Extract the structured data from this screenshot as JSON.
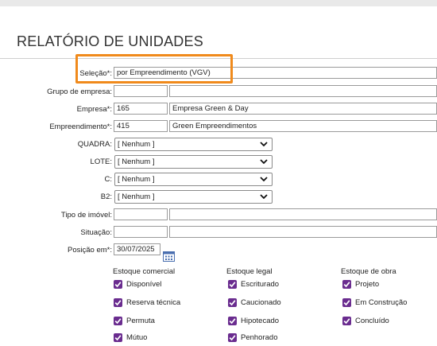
{
  "title": "RELATÓRIO DE UNIDADES",
  "form": {
    "selecao": {
      "label": "Seleção*:",
      "value": "por Empreendimento (VGV)"
    },
    "grupo": {
      "label": "Grupo de empresa:",
      "code": "",
      "name": ""
    },
    "empresa": {
      "label": "Empresa*:",
      "code": "165",
      "name": "Empresa Green & Day"
    },
    "empreendimento": {
      "label": "Empreendimento*:",
      "code": "415",
      "name": "Green Empreendimentos"
    },
    "quadra": {
      "label": "QUADRA:",
      "value": "[ Nenhum ]"
    },
    "lote": {
      "label": "LOTE:",
      "value": "[ Nenhum ]"
    },
    "c": {
      "label": "C:",
      "value": "[ Nenhum ]"
    },
    "b2": {
      "label": "B2:",
      "value": "[ Nenhum ]"
    },
    "tipo_imovel": {
      "label": "Tipo de imóvel:",
      "code": "",
      "name": ""
    },
    "situacao": {
      "label": "Situação:",
      "code": "",
      "name": ""
    },
    "posicao": {
      "label": "Posição em*:",
      "value": "30/07/2025"
    }
  },
  "estoque_comercial": {
    "header": "Estoque comercial",
    "items": [
      {
        "label": "Disponível",
        "checked": true
      },
      {
        "label": "Reserva técnica",
        "checked": true
      },
      {
        "label": "Permuta",
        "checked": true
      },
      {
        "label": "Mútuo",
        "checked": true
      }
    ]
  },
  "estoque_legal": {
    "header": "Estoque legal",
    "items": [
      {
        "label": "Escriturado",
        "checked": true
      },
      {
        "label": "Caucionado",
        "checked": true
      },
      {
        "label": "Hipotecado",
        "checked": true
      },
      {
        "label": "Penhorado",
        "checked": true
      }
    ]
  },
  "estoque_obra": {
    "header": "Estoque de obra",
    "items": [
      {
        "label": "Projeto",
        "checked": true
      },
      {
        "label": "Em Construção",
        "checked": true
      },
      {
        "label": "Concluído",
        "checked": true
      }
    ]
  },
  "colors": {
    "accent_highlight": "#f08a1c",
    "checkbox": "#6a2c8f",
    "calendar_icon": "#4a6fb0"
  },
  "icons": {
    "dropdown": "chevron-down-icon",
    "date_picker": "calendar-icon",
    "checkbox": "checkmark-icon"
  }
}
